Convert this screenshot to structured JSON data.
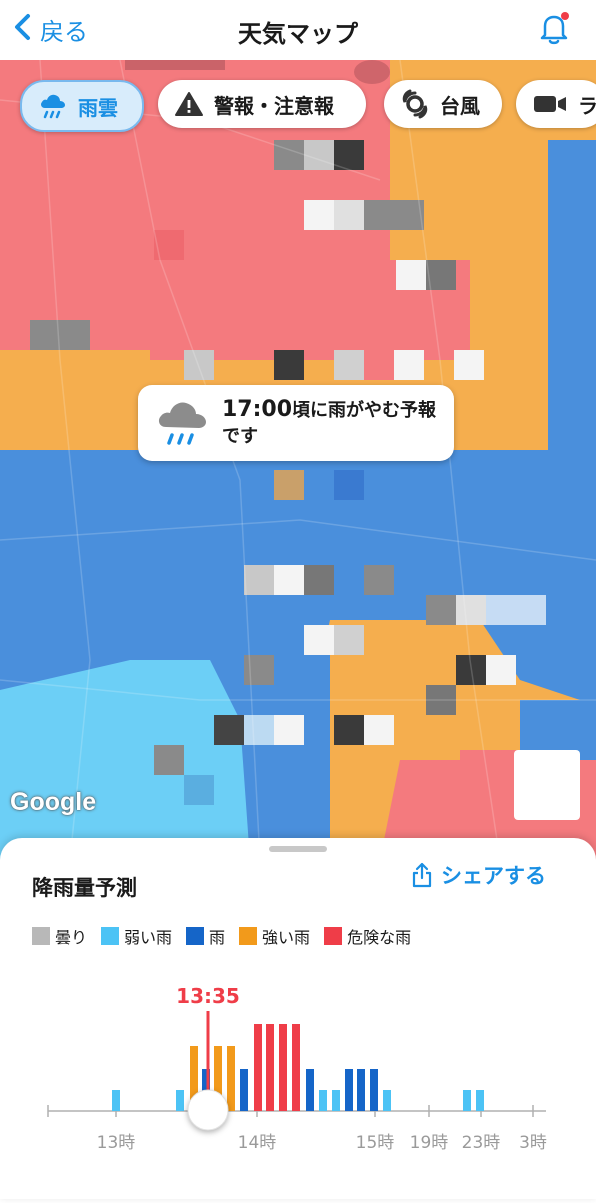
{
  "header": {
    "back_label": "戻る",
    "title": "天気マップ"
  },
  "chips": [
    {
      "label": "雨雲",
      "icon": "rain-cloud-icon",
      "active": true
    },
    {
      "label": "警報・注意報",
      "icon": "warning-icon",
      "active": false
    },
    {
      "label": "台風",
      "icon": "typhoon-icon",
      "active": false
    },
    {
      "label": "ラ",
      "icon": "camera-icon",
      "active": false
    }
  ],
  "bubble": {
    "time": "17:00",
    "message": "頃に雨がやむ予報です"
  },
  "map": {
    "attribution": "Google"
  },
  "sheet": {
    "title": "降雨量予測",
    "share_label": "シェアする",
    "legend": [
      {
        "label": "曇り",
        "color": "#b8b8b8"
      },
      {
        "label": "弱い雨",
        "color": "#4cc3f5"
      },
      {
        "label": "雨",
        "color": "#1565c8"
      },
      {
        "label": "強い雨",
        "color": "#f29a1b"
      },
      {
        "label": "危険な雨",
        "color": "#ef3d48"
      }
    ]
  },
  "chart_data": {
    "type": "bar",
    "title": "降雨量予測",
    "current_time_label": "13:35",
    "tick_labels": [
      "13時",
      "14時",
      "15時",
      "19時",
      "23時",
      "3時"
    ],
    "colors": {
      "cloudy": "#b8b8b8",
      "light": "#4cc3f5",
      "rain": "#1565c8",
      "heavy": "#f29a1b",
      "danger": "#ef3d48"
    },
    "bars": [
      {
        "level": 1,
        "type": "light"
      },
      {
        "level": 1,
        "type": "light"
      },
      {
        "level": 3,
        "type": "heavy"
      },
      {
        "level": 2,
        "type": "rain"
      },
      {
        "level": 3,
        "type": "heavy"
      },
      {
        "level": 3,
        "type": "heavy"
      },
      {
        "level": 2,
        "type": "rain"
      },
      {
        "level": 4,
        "type": "danger"
      },
      {
        "level": 4,
        "type": "danger"
      },
      {
        "level": 4,
        "type": "danger"
      },
      {
        "level": 4,
        "type": "danger"
      },
      {
        "level": 2,
        "type": "rain"
      },
      {
        "level": 1,
        "type": "light"
      },
      {
        "level": 1,
        "type": "light"
      },
      {
        "level": 2,
        "type": "rain"
      },
      {
        "level": 2,
        "type": "rain"
      },
      {
        "level": 2,
        "type": "rain"
      },
      {
        "level": 1,
        "type": "light"
      },
      {
        "level": 1,
        "type": "light"
      },
      {
        "level": 1,
        "type": "light"
      }
    ]
  }
}
